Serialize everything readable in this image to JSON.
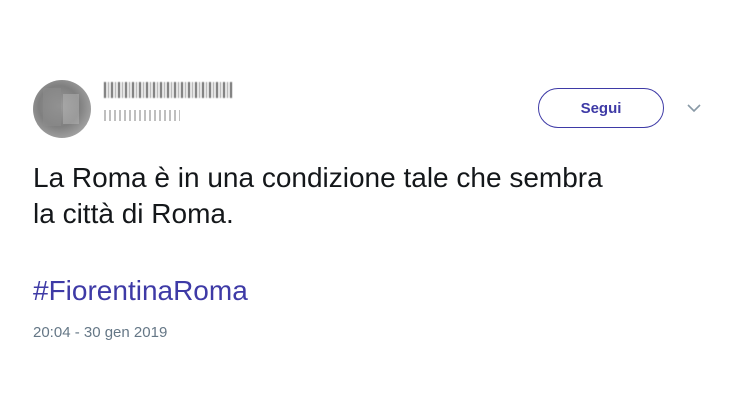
{
  "tweet": {
    "follow_label": "Segui",
    "text_line1": "La Roma è in una condizione tale che sembra",
    "text_line2": "la città di Roma.",
    "hashtag": "#FiorentinaRoma",
    "timestamp": "20:04 - 30 gen 2019"
  },
  "colors": {
    "accent": "#3e3aa6",
    "text": "#14171a",
    "muted": "#657786"
  },
  "icons": {
    "menu": "chevron-down-icon"
  }
}
